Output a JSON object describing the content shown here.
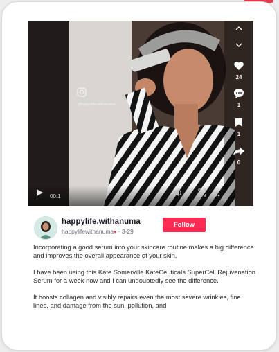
{
  "video": {
    "watermark_handle": "@happylife.withanuma",
    "time": "00:1",
    "actions": {
      "likes": "24",
      "comments": "1",
      "saves": "1",
      "shares": "0"
    }
  },
  "author": {
    "display_name": "happylife.withanuma",
    "handle": "happylifewithanuma",
    "date": "3-29"
  },
  "follow_label": "Follow",
  "caption": [
    "Incorporating a good serum into your skincare routine makes a big difference and improves the overall appearance of your skin.",
    "I have been using this Kate Somerville KateCeuticals SuperCell Rejuvenation Serum for a week now and I can undoubtedly see the difference.",
    "It boosts collagen and visibly repairs even the most severe wrinkles, fine lines, and damage from the sun, pollution, and"
  ],
  "colors": {
    "accent": "#fe2c55",
    "text": "#161823"
  }
}
